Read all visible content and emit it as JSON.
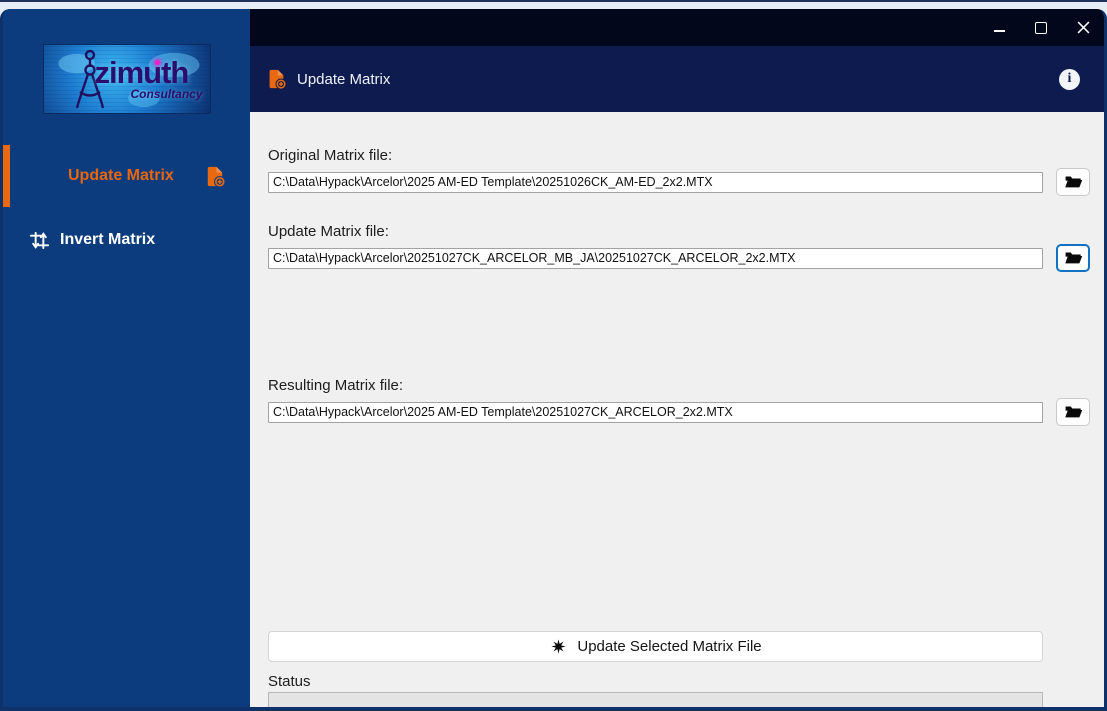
{
  "window": {
    "controls": [
      {
        "name": "minimize"
      },
      {
        "name": "maximize"
      },
      {
        "name": "close"
      }
    ]
  },
  "sidebar": {
    "logo": {
      "title": "zimuth",
      "subtitle": "Consultancy"
    },
    "items": [
      {
        "label": "Update Matrix",
        "active": true
      },
      {
        "label": "Invert Matrix",
        "active": false
      }
    ]
  },
  "header": {
    "title": "Update Matrix"
  },
  "form": {
    "fields": [
      {
        "label": "Original Matrix file:",
        "value": "C:\\Data\\Hypack\\Arcelor\\2025 AM-ED Template\\20251026CK_AM-ED_2x2.MTX"
      },
      {
        "label": "Update Matrix file:",
        "value": "C:\\Data\\Hypack\\Arcelor\\20251027CK_ARCELOR_MB_JA\\20251027CK_ARCELOR_2x2.MTX"
      },
      {
        "label": "Resulting Matrix file:",
        "value": "C:\\Data\\Hypack\\Arcelor\\2025 AM-ED Template\\20251027CK_ARCELOR_2x2.MTX"
      }
    ],
    "action_button": {
      "label": "Update Selected Matrix File"
    },
    "status": {
      "label": "Status",
      "progress_percent": 0
    }
  },
  "icons": {
    "header_icon": "document-add-icon",
    "sidebar_active_icon": "document-add-icon",
    "invert_icon": "swap-vertical-icon",
    "browse_icon": "folder-open-icon",
    "action_icon": "burst-star-icon",
    "info_icon": "info-icon"
  },
  "colors": {
    "accent_orange": "#E8690F",
    "sidebar_blue": "#0D3C7E",
    "header_navy": "#0E1B4E",
    "titlebar_black": "#03071C",
    "content_bg": "#F0F0F0",
    "focus_blue": "#1272C2",
    "window_border": "#0D3168"
  }
}
